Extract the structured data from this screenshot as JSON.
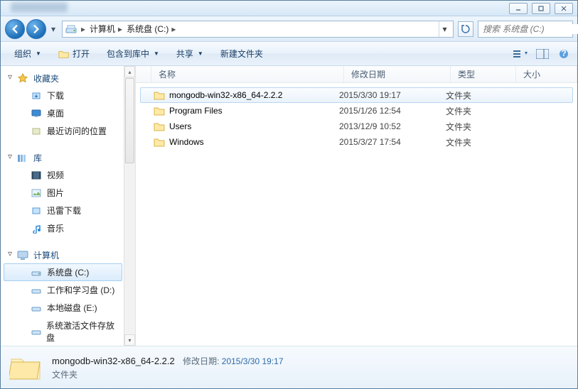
{
  "window": {
    "controls": {
      "min": "_",
      "max": "□",
      "close": "✕"
    }
  },
  "nav": {
    "path": [
      "计算机",
      "系统盘 (C:)"
    ],
    "search_placeholder": "搜索 系统盘 (C:)"
  },
  "toolbar": {
    "organize": "组织",
    "open": "打开",
    "include": "包含到库中",
    "share": "共享",
    "newfolder": "新建文件夹"
  },
  "columns": {
    "name": "名称",
    "date": "修改日期",
    "type": "类型",
    "size": "大小"
  },
  "sidebar": {
    "favorites": {
      "label": "收藏夹",
      "items": [
        "下载",
        "桌面",
        "最近访问的位置"
      ]
    },
    "libraries": {
      "label": "库",
      "items": [
        "视频",
        "图片",
        "迅雷下载",
        "音乐"
      ]
    },
    "computer": {
      "label": "计算机",
      "items": [
        "系统盘 (C:)",
        "工作和学习盘 (D:)",
        "本地磁盘 (E:)",
        "系统激活文件存放盘"
      ]
    }
  },
  "files": {
    "rows": [
      {
        "name": "mongodb-win32-x86_64-2.2.2",
        "date": "2015/3/30 19:17",
        "type": "文件夹",
        "size": "",
        "selected": true
      },
      {
        "name": "Program Files",
        "date": "2015/1/26 12:54",
        "type": "文件夹",
        "size": "",
        "selected": false
      },
      {
        "name": "Users",
        "date": "2013/12/9 10:52",
        "type": "文件夹",
        "size": "",
        "selected": false
      },
      {
        "name": "Windows",
        "date": "2015/3/27 17:54",
        "type": "文件夹",
        "size": "",
        "selected": false
      }
    ]
  },
  "details": {
    "name": "mongodb-win32-x86_64-2.2.2",
    "type": "文件夹",
    "meta_label": "修改日期:",
    "meta_value": "2015/3/30 19:17"
  }
}
